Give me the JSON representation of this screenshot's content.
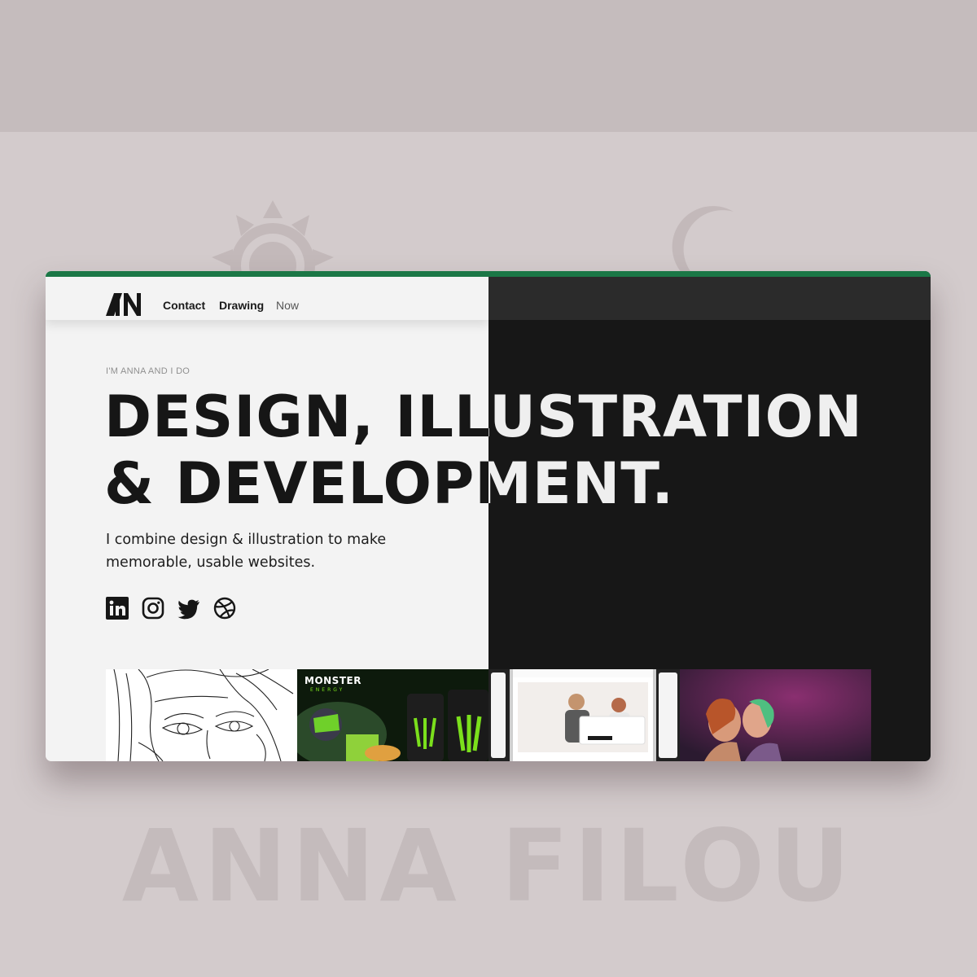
{
  "background": {
    "title": "ANNA FILOU",
    "icons": [
      "sun-icon",
      "moon-icon"
    ],
    "colors": {
      "page": "#d3cbcc",
      "band": "#c5bcbd"
    }
  },
  "browser": {
    "accent_color": "#1b7746"
  },
  "nav": {
    "logo": "AN",
    "links": [
      "Contact",
      "Drawing",
      "Now"
    ]
  },
  "hero": {
    "eyebrow": "I'M ANNA AND I DO",
    "headline_line1": "DESIGN, ILLUSTRATION",
    "headline_line2": "& DEVELOPMENT.",
    "intro": "I combine design & illustration to make memorable, usable websites."
  },
  "social": [
    "linkedin-icon",
    "instagram-icon",
    "twitter-icon",
    "dribbble-icon"
  ],
  "gallery": {
    "items": [
      {
        "name": "sketch-portrait-thumb",
        "brand_text": ""
      },
      {
        "name": "monster-energy-thumb",
        "brand_text": "MONSTER",
        "brand_subtext": "ENERGY"
      },
      {
        "name": "website-mockup-thumb",
        "brand_text": ""
      },
      {
        "name": "illustration-couple-thumb",
        "brand_text": ""
      }
    ]
  }
}
